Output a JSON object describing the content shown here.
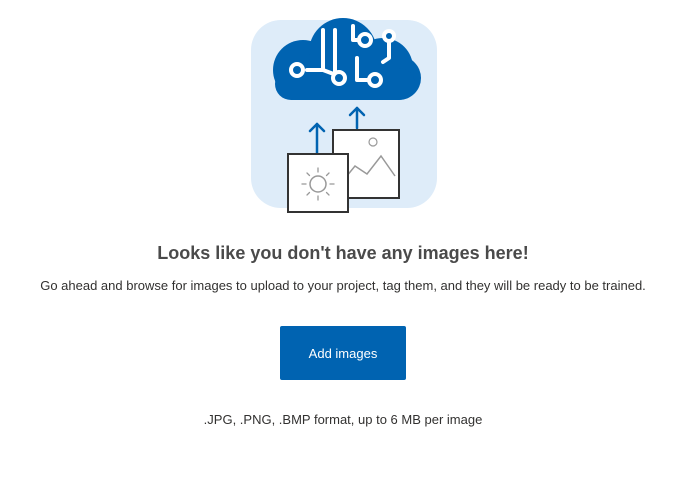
{
  "empty_state": {
    "illustration_icon": "cloud-upload-images-icon",
    "title": "Looks like you don't have any images here!",
    "description": "Go ahead and browse for images to upload to your project, tag them, and they will be ready to be trained.",
    "add_button_label": "Add images",
    "format_note": ".JPG, .PNG, .BMP format, up to 6 MB per image"
  },
  "colors": {
    "accent": "#0063b1",
    "illustration_background": "#deecf9",
    "cloud": "#0063b1",
    "title_text": "#4a4a4a"
  }
}
